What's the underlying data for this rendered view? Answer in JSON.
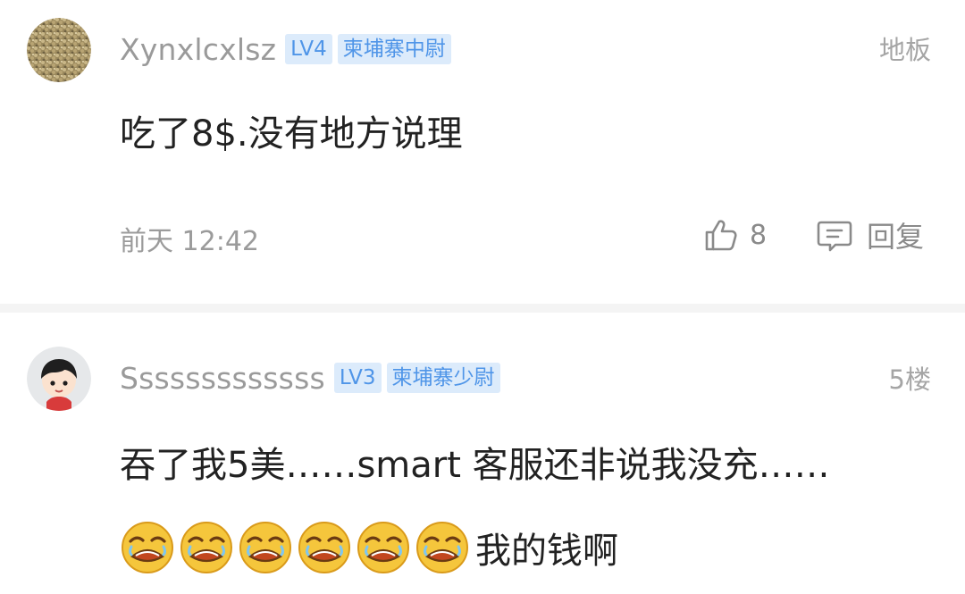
{
  "comments": [
    {
      "username": "Xynxlcxlsz",
      "level": "LV4",
      "title": "柬埔寨中尉",
      "floor": "地板",
      "text": "吃了8$.没有地方说理",
      "time": "前天 12:42",
      "likes": "8",
      "reply_label": "回复",
      "avatar_icon": "textured-avatar"
    },
    {
      "username": "Sssssssssssss",
      "level": "LV3",
      "title": "柬埔寨少尉",
      "floor": "5楼",
      "text": "吞了我5美……smart 客服还非说我没充……",
      "emoji_count": 6,
      "emoji_icon": "crying-face-emoji",
      "emoji_text": "我的钱啊",
      "avatar_icon": "cartoon-child-avatar"
    }
  ],
  "colors": {
    "badge_bg": "#dcebfb",
    "badge_text": "#4f95e8",
    "meta_text": "#9b9b9b",
    "body_text": "#222222",
    "divider": "#f4f4f4"
  }
}
